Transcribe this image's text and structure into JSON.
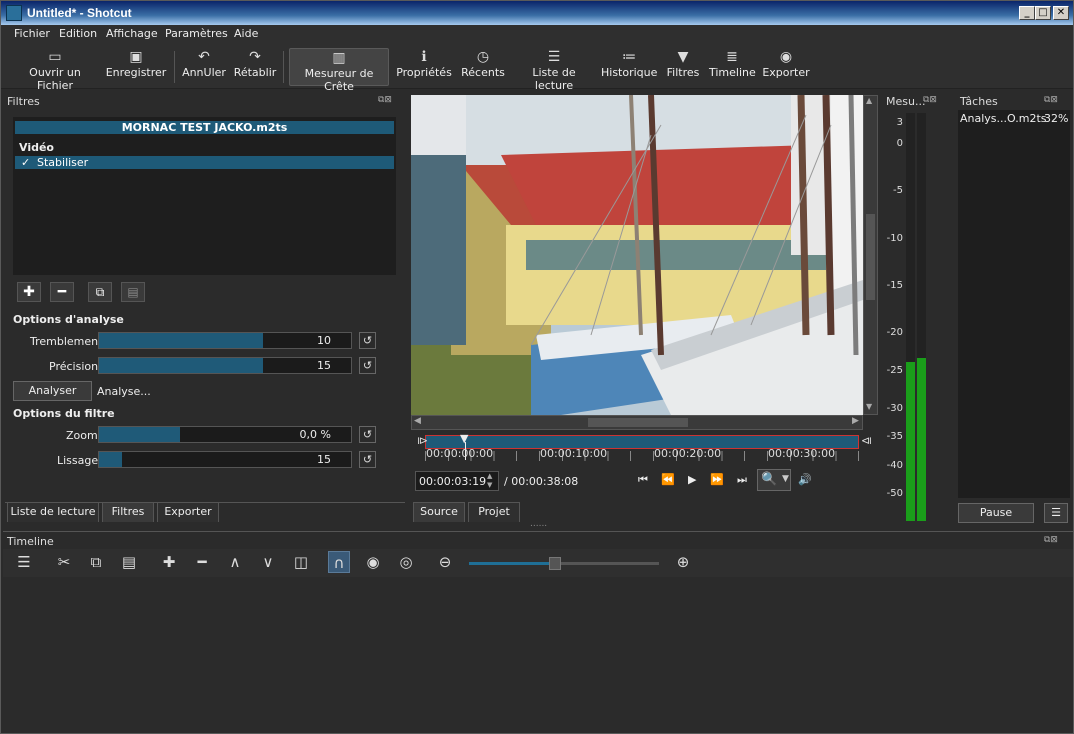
{
  "window": {
    "title": "Untitled* - Shotcut"
  },
  "menu": [
    "Fichier",
    "Edition",
    "Affichage",
    "Paramètres",
    "Aide"
  ],
  "toolbar": [
    {
      "label": "Ouvrir un Fichier",
      "icon": "folder-open-icon"
    },
    {
      "label": "Enregistrer",
      "icon": "save-icon"
    },
    {
      "label": "AnnUler",
      "icon": "undo-icon"
    },
    {
      "label": "Rétablir",
      "icon": "redo-icon"
    },
    {
      "label": "Mesureur de Crête",
      "icon": "peak-meter-icon",
      "active": true
    },
    {
      "label": "Propriétés",
      "icon": "info-icon"
    },
    {
      "label": "Récents",
      "icon": "clock-icon"
    },
    {
      "label": "Liste de lecture",
      "icon": "list-icon"
    },
    {
      "label": "Historique",
      "icon": "history-icon"
    },
    {
      "label": "Filtres",
      "icon": "filter-icon"
    },
    {
      "label": "Timeline",
      "icon": "timeline-icon"
    },
    {
      "label": "Exporter",
      "icon": "export-icon"
    }
  ],
  "filters": {
    "title": "Filtres",
    "clip_name": "MORNAC TEST JACKO.m2ts",
    "category": "Vidéo",
    "items": [
      {
        "label": "Stabiliser",
        "checked": true
      }
    ],
    "analysis_header": "Options d'analyse",
    "tremblement_label": "Tremblement",
    "tremblement_value": "10",
    "tremblement_fraction": 0.65,
    "precision_label": "Précision",
    "precision_value": "15",
    "precision_fraction": 0.65,
    "analyze_button": "Analyser",
    "analyze_status": "Analyse...",
    "filter_header": "Options du filtre",
    "zoom_label": "Zoom",
    "zoom_value": "0,0 %",
    "zoom_fraction": 0.32,
    "lissage_label": "Lissage",
    "lissage_value": "15",
    "lissage_fraction": 0.09
  },
  "left_tabs": [
    "Liste de lecture",
    "Filtres",
    "Exporter"
  ],
  "player": {
    "ruler_labels": [
      "00:00:00:00",
      "00:00:10:00",
      "00:00:20:00",
      "00:00:30:00"
    ],
    "position": "00:00:03:19",
    "duration": "/ 00:00:38:08",
    "tabs": [
      "Source",
      "Projet"
    ],
    "dots": "......"
  },
  "meter": {
    "title": "Mesu...",
    "scale": [
      "3",
      "0",
      "-5",
      "-10",
      "-15",
      "-20",
      "-25",
      "-30",
      "-35",
      "-40",
      "-50"
    ],
    "level_left": 0.39,
    "level_right": 0.4,
    "bar_color": "#1a9e1a"
  },
  "tasks": {
    "title": "Tâches",
    "item_name": "Analys...O.m2ts",
    "item_progress": "32%",
    "pause_button": "Pause"
  },
  "timeline": {
    "title": "Timeline",
    "zoom_level": 0.45
  },
  "colors": {
    "accent": "#1f5a78",
    "selection": "#1e5a78"
  }
}
